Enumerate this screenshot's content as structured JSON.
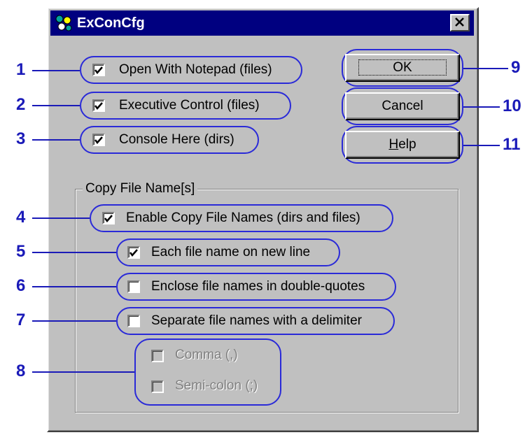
{
  "window": {
    "title": "ExConCfg",
    "close_glyph": "✕"
  },
  "checkboxes": [
    {
      "label": "Open With Notepad (files)",
      "checked": true,
      "enabled": true
    },
    {
      "label": "Executive Control (files)",
      "checked": true,
      "enabled": true
    },
    {
      "label": "Console Here (dirs)",
      "checked": true,
      "enabled": true
    }
  ],
  "group": {
    "label": "Copy File Name[s]",
    "options": [
      {
        "label": "Enable Copy File Names (dirs and files)",
        "checked": true,
        "enabled": true
      },
      {
        "label": "Each file name on new line",
        "checked": true,
        "enabled": true
      },
      {
        "label": "Enclose file names in double-quotes",
        "checked": false,
        "enabled": true
      },
      {
        "label": "Separate file names with a delimiter",
        "checked": false,
        "enabled": true
      }
    ],
    "delimiters": [
      {
        "label": "Comma (,)",
        "checked": false,
        "enabled": false
      },
      {
        "label": "Semi-colon (;)",
        "checked": false,
        "enabled": false
      }
    ]
  },
  "buttons": {
    "ok": "OK",
    "cancel": "Cancel",
    "help_prefix": "H",
    "help_rest": "elp"
  },
  "callouts": [
    "1",
    "2",
    "3",
    "4",
    "5",
    "6",
    "7",
    "8",
    "9",
    "10",
    "11"
  ],
  "colors": {
    "title_bar": "#000080",
    "face": "#c0c0c0",
    "annotation": "#1a1ab8"
  }
}
